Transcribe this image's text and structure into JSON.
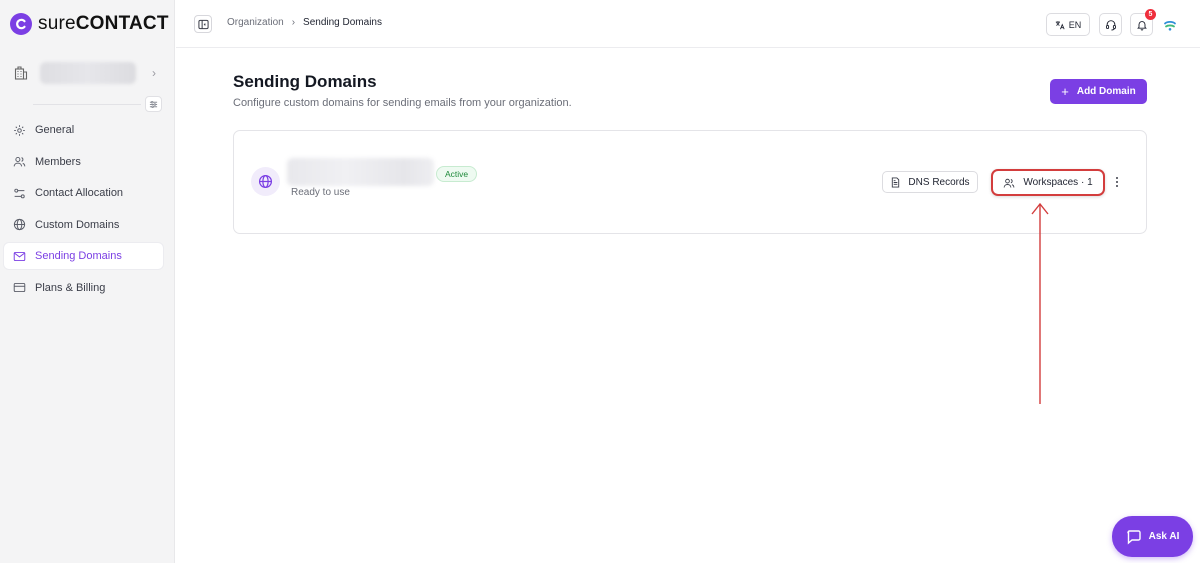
{
  "app": {
    "brand_light": "sure",
    "brand_bold": "CONTACT",
    "accent_color": "#7b3fe4"
  },
  "sidebar": {
    "items": [
      {
        "label": "General",
        "icon": "gear-icon"
      },
      {
        "label": "Members",
        "icon": "users-icon"
      },
      {
        "label": "Contact Allocation",
        "icon": "allocation-icon"
      },
      {
        "label": "Custom Domains",
        "icon": "globe-icon"
      },
      {
        "label": "Sending Domains",
        "icon": "mail-icon",
        "active": true
      },
      {
        "label": "Plans & Billing",
        "icon": "credit-card-icon"
      }
    ]
  },
  "header": {
    "breadcrumb": [
      "Organization",
      "Sending Domains"
    ],
    "language": "EN",
    "notification_count": "5"
  },
  "main": {
    "title": "Sending Domains",
    "subtitle": "Configure custom domains for sending emails from your organization.",
    "add_button_label": "Add Domain",
    "add_button_icon": "+",
    "domain": {
      "status": "Active",
      "status_color": "#1f8a3b",
      "description": "Ready to use",
      "dns_button_label": "DNS Records",
      "workspaces_button_label": "Workspaces · 1"
    }
  },
  "annotation": {
    "highlight_color": "#d33d3d"
  },
  "ask_ai": {
    "label": "Ask AI"
  }
}
